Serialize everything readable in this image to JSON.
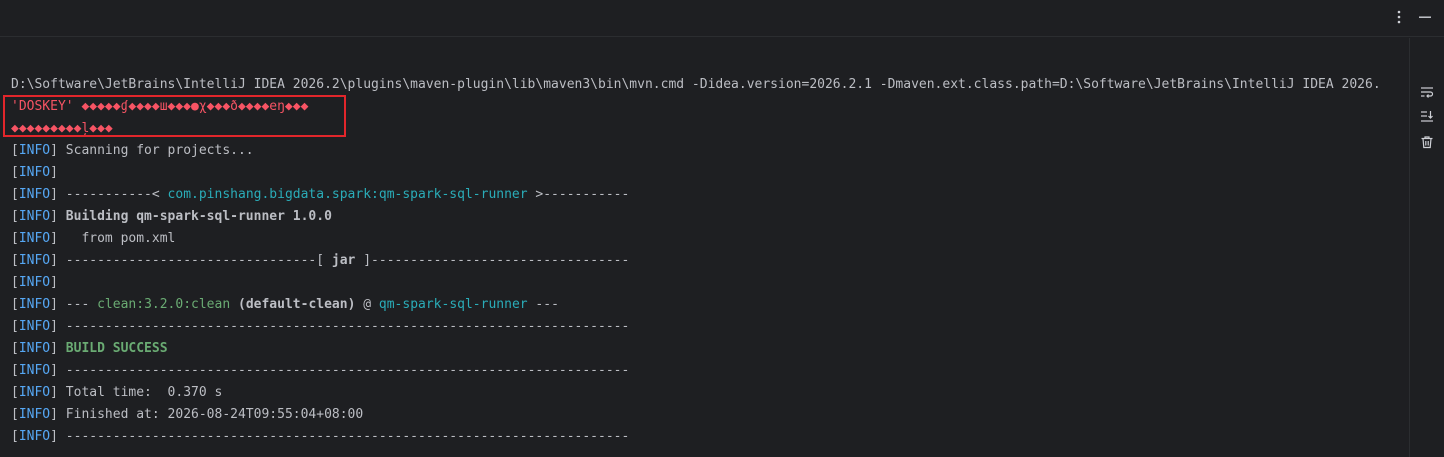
{
  "toolbar": {
    "options_icon": "kebab-vertical-icon",
    "minimize_icon": "minimize-icon"
  },
  "side_toolbar": {
    "items": [
      {
        "name": "soft-wrap-icon"
      },
      {
        "name": "scroll-to-end-icon"
      },
      {
        "name": "clear-all-icon"
      }
    ]
  },
  "console": {
    "command_line": "D:\\Software\\JetBrains\\IntelliJ IDEA 2026.2\\plugins\\maven-plugin\\lib\\maven3\\bin\\mvn.cmd -Didea.version=2026.2.1 -Dmaven.ext.class.path=D:\\Software\\JetBrains\\IntelliJ IDEA 2026.",
    "error_line_1": "'DOSKEY' ◆◆◆◆◆ɠ◆◆◆◆ш◆◆◆●χ◆◆◆ð◆◆◆◆eŋ◆◆◆",
    "error_line_2": "◆◆◆◆◆◆◆◆◆ļ◆◆◆",
    "info_open": "[",
    "info_word": "INFO",
    "info_close": "]",
    "lines": {
      "scanning": " Scanning for projects...",
      "sep_left": " -----------< ",
      "artifact": "com.pinshang.bigdata.spark:qm-spark-sql-runner",
      "sep_right": " >-----------",
      "building": " Building qm-spark-sql-runner 1.0.0",
      "from_pom": "   from pom.xml",
      "jar_left": " --------------------------------[ ",
      "jar_word": "jar",
      "jar_right": " ]---------------------------------",
      "clean_prefix": " --- ",
      "clean_plugin": "clean:3.2.0:clean",
      "clean_exec": " (default-clean)",
      "clean_at": " @ ",
      "clean_project": "qm-spark-sql-runner",
      "clean_suffix": " ---",
      "dashes": " ------------------------------------------------------------------------",
      "build_success": " BUILD SUCCESS",
      "total_time": " Total time:  0.370 s",
      "finished_at": " Finished at: 2026-08-24T09:55:04+08:00"
    }
  },
  "colors": {
    "background": "#1e1f22",
    "info": "#56a8f5",
    "error": "#f75464",
    "link": "#2aacb8",
    "success": "#6aab73",
    "highlight_box": "#e2262b"
  }
}
